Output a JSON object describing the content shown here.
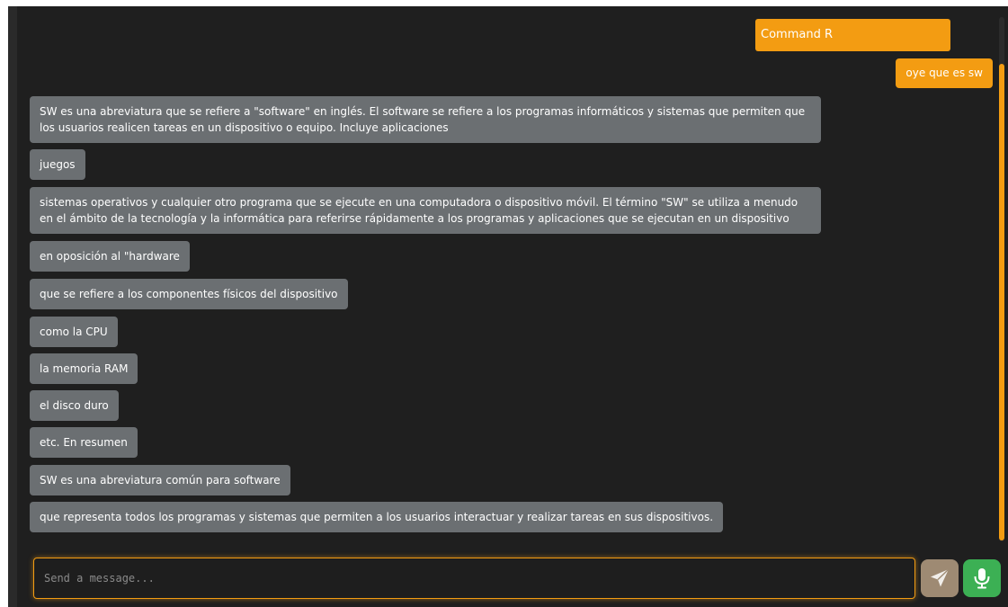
{
  "header": {
    "model_label": "Command R"
  },
  "chat": {
    "user_message": "oye que es sw",
    "bot_messages": [
      "SW es una abreviatura que se refiere a \"software\" en inglés. El software se refiere a los programas informáticos y sistemas que permiten que los usuarios realicen tareas en un dispositivo o equipo. Incluye aplicaciones",
      "juegos",
      "sistemas operativos y cualquier otro programa que se ejecute en una computadora o dispositivo móvil. El término \"SW\" se utiliza a menudo en el ámbito de la tecnología y la informática para referirse rápidamente a los programas y aplicaciones que se ejecutan en un dispositivo",
      "en oposición al \"hardware",
      "que se refiere a los componentes físicos del dispositivo",
      "como la CPU",
      "la memoria RAM",
      "el disco duro",
      "etc. En resumen",
      "SW es una abreviatura común para software",
      "que representa todos los programas y sistemas que permiten a los usuarios interactuar y realizar tareas en sus dispositivos."
    ]
  },
  "composer": {
    "placeholder": "Send a message...",
    "value": ""
  },
  "icons": {
    "send": "send-icon",
    "mic": "microphone-icon"
  },
  "colors": {
    "accent": "#f39c12",
    "background": "#1f1f1f",
    "bot_bubble": "#6b6f72",
    "send_button": "#9e8a73",
    "mic_button": "#3cb054"
  }
}
